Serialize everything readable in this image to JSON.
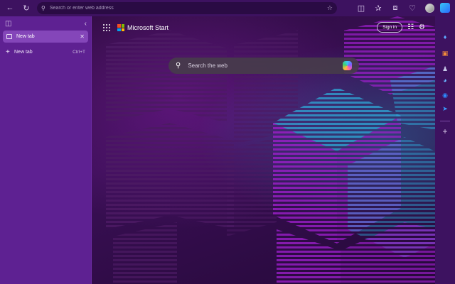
{
  "toolbar": {
    "address_placeholder": "Search or enter web address"
  },
  "tab_panel": {
    "active_tab_label": "New tab",
    "new_tab_label": "New tab",
    "new_tab_shortcut": "Ctrl+T"
  },
  "content": {
    "brand": "Microsoft Start",
    "sign_in_label": "Sign in",
    "search_placeholder": "Search the web"
  },
  "icons": {
    "toolbar_left": [
      "back-icon",
      "refresh-icon"
    ],
    "toolbar_right": [
      "favorite-star-icon",
      "split-screen-icon",
      "favorites-icon",
      "collections-icon",
      "browser-essentials-icon",
      "profile-avatar",
      "more-icon"
    ],
    "right_sidebar": [
      "copilot-icon",
      "tag-icon",
      "briefcase-icon",
      "games-icon",
      "discover-icon",
      "outlook-icon",
      "send-icon",
      "add-icon"
    ]
  },
  "colors": {
    "accent": "#8446b9",
    "panel": "#5e2192",
    "toolbar": "#3d1260"
  }
}
